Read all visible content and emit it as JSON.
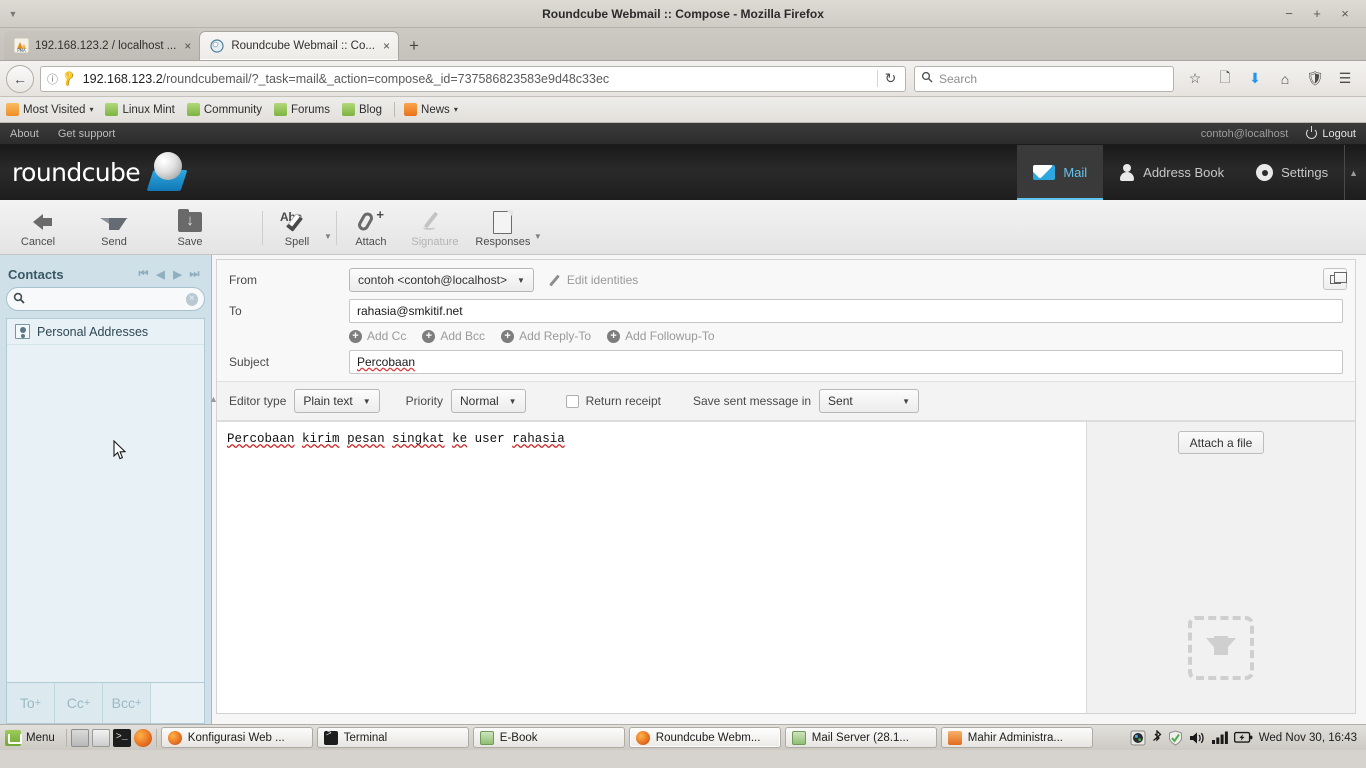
{
  "window": {
    "title": "Roundcube Webmail :: Compose - Mozilla Firefox",
    "minimize": "−",
    "maximize": "+",
    "close": "×",
    "menu_caret": "▼"
  },
  "browser": {
    "tabs": [
      {
        "label": "192.168.123.2 / localhost ...",
        "favicon": "phpmyadmin-icon",
        "close": "×",
        "active": false
      },
      {
        "label": "Roundcube Webmail :: Co...",
        "favicon": "roundcube-icon",
        "close": "×",
        "active": true
      }
    ],
    "new_tab": "+",
    "back": "←",
    "url_host": "192.168.123.2",
    "url_path": "/roundcubemail/?_task=mail&_action=compose&_id=737586823583e9d48c33ec",
    "reload": "↻",
    "search_placeholder": "Search",
    "nav_icons": [
      "bookmark-star-icon",
      "reader-list-icon",
      "downloads-icon",
      "home-icon",
      "pocket-icon",
      "hamburger-menu-icon"
    ],
    "bookmarks": [
      {
        "label": "Most Visited",
        "icon": "folder-icon",
        "caret": "▾"
      },
      {
        "label": "Linux Mint",
        "icon": "mint-icon",
        "caret": ""
      },
      {
        "label": "Community",
        "icon": "mint-icon",
        "caret": ""
      },
      {
        "label": "Forums",
        "icon": "mint-icon",
        "caret": ""
      },
      {
        "label": "Blog",
        "icon": "mint-icon",
        "caret": ""
      },
      {
        "label": "News",
        "icon": "rss-icon",
        "caret": "▾"
      }
    ]
  },
  "roundcube": {
    "topbar": {
      "about": "About",
      "support": "Get support",
      "user": "contoh@localhost",
      "logout": "Logout"
    },
    "logo_text": "roundcube",
    "tasks": [
      {
        "label": "Mail",
        "icon": "envelope-icon",
        "selected": true
      },
      {
        "label": "Address Book",
        "icon": "person-icon",
        "selected": false
      },
      {
        "label": "Settings",
        "icon": "gear-icon",
        "selected": false
      }
    ],
    "tasks_caret": "▲",
    "toolbar": [
      {
        "label": "Cancel",
        "icon": "arrow-left-icon",
        "disabled": false,
        "caret": false
      },
      {
        "label": "Send",
        "icon": "paper-plane-icon",
        "disabled": false,
        "caret": false
      },
      {
        "label": "Save",
        "icon": "save-folder-icon",
        "disabled": false,
        "caret": false
      },
      {
        "label": "Spell",
        "icon": "spellcheck-icon",
        "disabled": false,
        "caret": true
      },
      {
        "label": "Attach",
        "icon": "paperclip-plus-icon",
        "disabled": false,
        "caret": false
      },
      {
        "label": "Signature",
        "icon": "pen-icon",
        "disabled": true,
        "caret": false
      },
      {
        "label": "Responses",
        "icon": "document-icon",
        "disabled": false,
        "caret": true
      }
    ],
    "sidebar": {
      "title": "Contacts",
      "nav": [
        "⏮",
        "◀",
        "▶",
        "⏭"
      ],
      "search_value": "",
      "search_clear": "×",
      "items": [
        {
          "label": "Personal Addresses",
          "icon": "address-book-icon"
        }
      ],
      "footer_buttons": [
        {
          "label": "To",
          "sup": "+"
        },
        {
          "label": "Cc",
          "sup": "+"
        },
        {
          "label": "Bcc",
          "sup": "+"
        }
      ]
    },
    "compose": {
      "from_label": "From",
      "from_value": "contoh <contoh@localhost>",
      "edit_identities": "Edit identities",
      "to_label": "To",
      "to_value": "rahasia@smkitif.net",
      "add_links": [
        "Add Cc",
        "Add Bcc",
        "Add Reply-To",
        "Add Followup-To"
      ],
      "subject_label": "Subject",
      "subject_value": "Percobaan",
      "editor_type_label": "Editor type",
      "editor_type_value": "Plain text",
      "priority_label": "Priority",
      "priority_value": "Normal",
      "return_receipt_label": "Return receipt",
      "return_receipt_checked": false,
      "save_sent_label": "Save sent message in",
      "save_sent_value": "Sent",
      "body_words": [
        {
          "text": "Percobaan",
          "misspelled": true
        },
        {
          "text": "kirim",
          "misspelled": true
        },
        {
          "text": "pesan",
          "misspelled": true
        },
        {
          "text": "singkat",
          "misspelled": true
        },
        {
          "text": "ke",
          "misspelled": true
        },
        {
          "text": "user",
          "misspelled": false
        },
        {
          "text": "rahasia",
          "misspelled": true
        }
      ],
      "attach_button": "Attach a file",
      "dropzone_icon": "download-arrow-icon",
      "maximize_icon": "restore-window-icon"
    }
  },
  "taskbar": {
    "menu_label": "Menu",
    "quick_icons": [
      "show-desktop-icon",
      "window-list-icon",
      "terminal-icon",
      "firefox-icon"
    ],
    "tasks": [
      {
        "label": "Konfigurasi Web ...",
        "icon": "firefox-icon",
        "active": false
      },
      {
        "label": "Terminal",
        "icon": "terminal-icon",
        "active": false
      },
      {
        "label": "E-Book",
        "icon": "folder-icon",
        "active": false
      },
      {
        "label": "Roundcube Webm...",
        "icon": "firefox-icon",
        "active": true
      },
      {
        "label": "Mail Server (28.1...",
        "icon": "folder-icon",
        "active": false
      },
      {
        "label": "Mahir Administra...",
        "icon": "book-icon",
        "active": false
      }
    ],
    "tray_icons": [
      "display-icon",
      "bluetooth-icon",
      "shield-icon",
      "volume-icon",
      "network-icon",
      "battery-icon"
    ],
    "clock": "Wed Nov 30, 16:43"
  }
}
